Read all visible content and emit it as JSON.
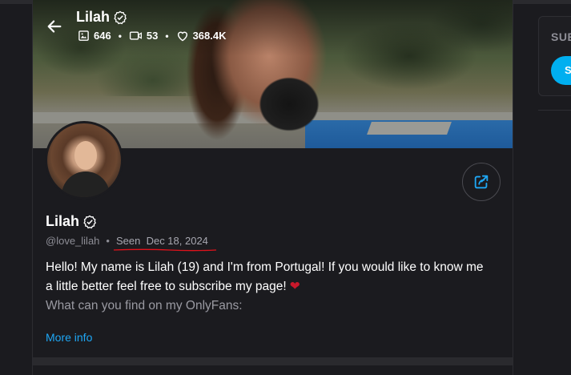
{
  "cover": {
    "name": "Lilah",
    "stats": {
      "photos": "646",
      "videos": "53",
      "likes": "368.4K"
    }
  },
  "profile": {
    "name": "Lilah",
    "handle": "@love_lilah",
    "seen_label": "Seen",
    "seen_date": "Dec 18, 2024",
    "bio_line1": "Hello! My name is Lilah (19) and I'm from Portugal! If you would like to know me",
    "bio_line2": "a little better feel free to subscribe my page!",
    "bio_line3": "What can you find on my OnlyFans:",
    "more_info": "More info"
  },
  "sidebar": {
    "title": "SUB",
    "button": "S"
  },
  "colors": {
    "accent": "#00aff0",
    "link": "#1ea7f5",
    "annotation": "#e0121b",
    "heart": "#c8182b"
  },
  "icons": [
    "back-arrow-icon",
    "verified-icon",
    "image-icon",
    "video-icon",
    "heart-icon",
    "share-icon"
  ]
}
